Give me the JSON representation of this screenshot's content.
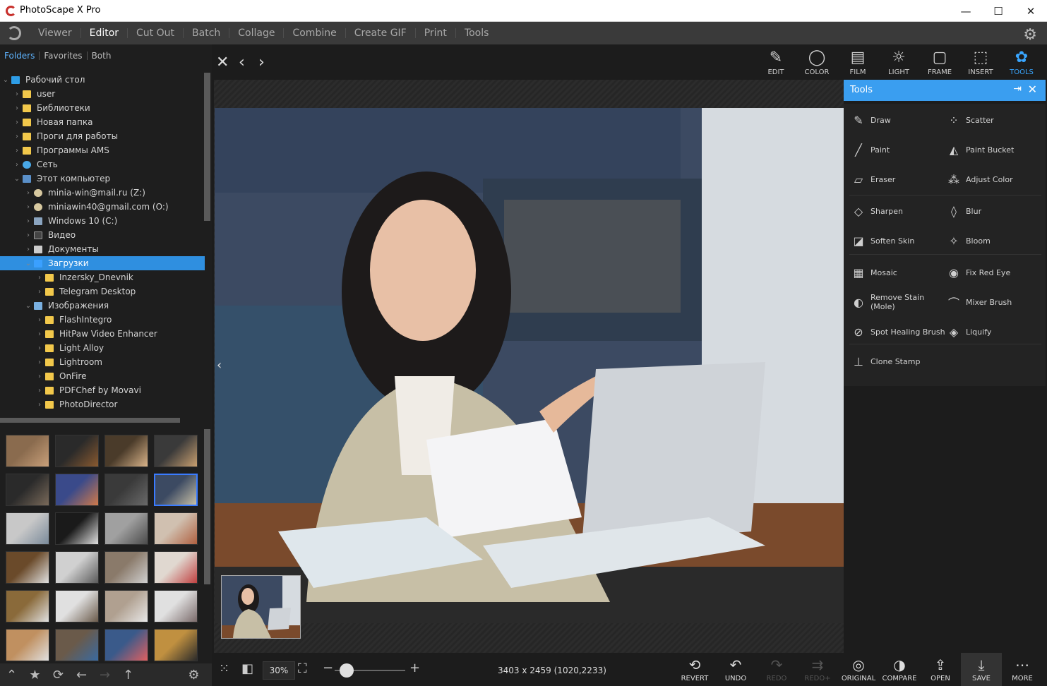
{
  "window": {
    "title": "PhotoScape X Pro",
    "minimize": "—",
    "maximize": "☐",
    "close": "✕"
  },
  "menu": {
    "items": [
      "Viewer",
      "Editor",
      "Cut Out",
      "Batch",
      "Collage",
      "Combine",
      "Create GIF",
      "Print",
      "Tools"
    ],
    "active": "Editor",
    "settings_icon": "gear-icon"
  },
  "browser": {
    "tabs": [
      "Folders",
      "Favorites",
      "Both"
    ],
    "active_tab": "Folders",
    "tree": [
      {
        "label": "Рабочий стол",
        "icon": "desk",
        "expanded": true
      },
      {
        "label": "user",
        "icon": "folder"
      },
      {
        "label": "Библиотеки",
        "icon": "folder"
      },
      {
        "label": "Новая папка",
        "icon": "folder"
      },
      {
        "label": "Проги для работы",
        "icon": "folder"
      },
      {
        "label": "Программы AMS",
        "icon": "folder"
      },
      {
        "label": "Сеть",
        "icon": "net"
      },
      {
        "label": "Этот компьютер",
        "icon": "pc",
        "expanded": true
      },
      {
        "label": "minia-win@mail.ru (Z:)",
        "icon": "user"
      },
      {
        "label": "miniawin40@gmail.com (O:)",
        "icon": "user"
      },
      {
        "label": "Windows 10 (C:)",
        "icon": "drive"
      },
      {
        "label": "Видео",
        "icon": "video"
      },
      {
        "label": "Документы",
        "icon": "doc"
      },
      {
        "label": "Загрузки",
        "icon": "dl",
        "selected": true,
        "expanded": true
      },
      {
        "label": "Inzersky_Dnevnik",
        "icon": "folder"
      },
      {
        "label": "Telegram Desktop",
        "icon": "folder"
      },
      {
        "label": "Изображения",
        "icon": "img",
        "expanded": true
      },
      {
        "label": "FlashIntegro",
        "icon": "folder"
      },
      {
        "label": "HitPaw Video Enhancer",
        "icon": "folder"
      },
      {
        "label": "Light Alloy",
        "icon": "folder"
      },
      {
        "label": "Lightroom",
        "icon": "folder"
      },
      {
        "label": "OnFire",
        "icon": "folder"
      },
      {
        "label": "PDFChef by Movavi",
        "icon": "folder"
      },
      {
        "label": "PhotoDirector",
        "icon": "folder"
      }
    ],
    "bottom_icons": [
      "chevron-up-icon",
      "star-icon",
      "refresh-icon",
      "arrow-left-icon",
      "arrow-right-icon",
      "arrow-up-icon",
      "gear-icon"
    ]
  },
  "editor_tabs": [
    {
      "label": "EDIT",
      "icon": "✎"
    },
    {
      "label": "COLOR",
      "icon": "◯"
    },
    {
      "label": "FILM",
      "icon": "▤"
    },
    {
      "label": "LIGHT",
      "icon": "☼"
    },
    {
      "label": "FRAME",
      "icon": "▢"
    },
    {
      "label": "INSERT",
      "icon": "⬚"
    },
    {
      "label": "TOOLS",
      "icon": "✿"
    }
  ],
  "active_editor_tab": "TOOLS",
  "tools_panel": {
    "title": "Tools",
    "pin_icon": "pin-icon",
    "close_icon": "close-icon",
    "tools": [
      {
        "label": "Draw",
        "icon": "✎"
      },
      {
        "label": "Scatter",
        "icon": "⁘"
      },
      {
        "label": "Paint",
        "icon": "╱"
      },
      {
        "label": "Paint Bucket",
        "icon": "◭"
      },
      {
        "label": "Eraser",
        "icon": "▱"
      },
      {
        "label": "Adjust Color",
        "icon": "⁂"
      },
      {
        "label": "Sharpen",
        "icon": "◇"
      },
      {
        "label": "Blur",
        "icon": "◊"
      },
      {
        "label": "Soften Skin",
        "icon": "◪"
      },
      {
        "label": "Bloom",
        "icon": "✧"
      },
      {
        "label": "Mosaic",
        "icon": "▦"
      },
      {
        "label": "Fix Red Eye",
        "icon": "◉"
      },
      {
        "label": "Remove Stain\n(Mole)",
        "icon": "◐"
      },
      {
        "label": "Mixer Brush",
        "icon": "⌒"
      },
      {
        "label": "Spot Healing Brush",
        "icon": "⊘"
      },
      {
        "label": "Liquify",
        "icon": "◈"
      },
      {
        "label": "Clone Stamp",
        "icon": "⊥"
      }
    ]
  },
  "status": {
    "zoom": "30%",
    "dimensions": "3403 x 2459 (1020,2233)"
  },
  "actions": [
    {
      "label": "REVERT",
      "icon": "⟲",
      "enabled": true
    },
    {
      "label": "UNDO",
      "icon": "↶",
      "enabled": true
    },
    {
      "label": "REDO",
      "icon": "↷",
      "enabled": false
    },
    {
      "label": "REDO+",
      "icon": "⇉",
      "enabled": false
    },
    {
      "label": "ORIGINAL",
      "icon": "◎",
      "enabled": true
    },
    {
      "label": "COMPARE",
      "icon": "◑",
      "enabled": true
    },
    {
      "label": "OPEN",
      "icon": "⇪",
      "enabled": true
    },
    {
      "label": "SAVE",
      "icon": "⤓",
      "enabled": true
    },
    {
      "label": "MORE",
      "icon": "⋯",
      "enabled": true
    }
  ],
  "colors": {
    "accent": "#3a9ef0",
    "selection": "#2f8fe0"
  }
}
